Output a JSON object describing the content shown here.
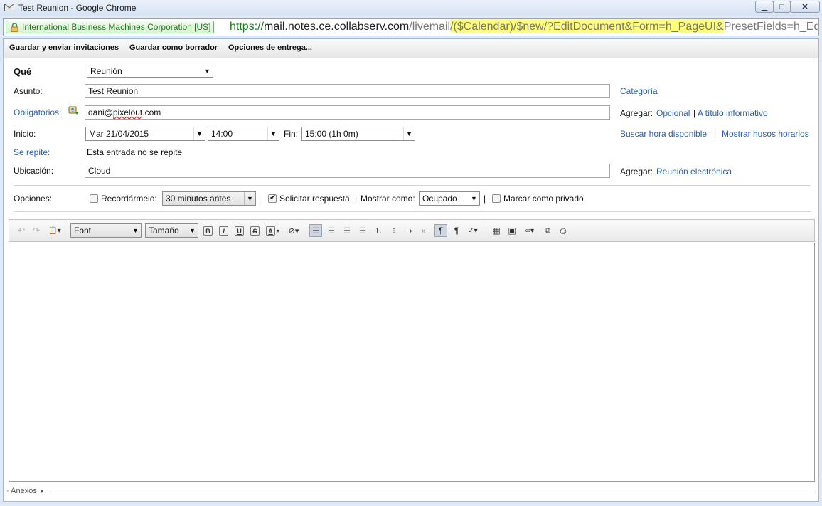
{
  "window": {
    "title": "Test Reunion - Google Chrome",
    "min_symbol": "▁",
    "max_symbol": "□",
    "close_symbol": "✕"
  },
  "addressbar": {
    "ev_label": "International Business Machines Corporation [US]",
    "url_scheme": "https://",
    "url_host": "mail.notes.ce.collabserv.com",
    "url_path_pre": "/livemail",
    "url_path_highlight": "/($Calendar)/$new/?EditDocument&Form=h_PageUI&",
    "url_path_post": "PresetFields=h_Edi"
  },
  "actions": {
    "save_send": "Guardar y enviar invitaciones",
    "save_draft": "Guardar como borrador",
    "delivery_options": "Opciones de entrega..."
  },
  "form": {
    "que_label": "Qué",
    "que_value": "Reunión",
    "asunto_label": "Asunto:",
    "asunto_value": "Test Reunion",
    "categoria_link": "Categoría",
    "obligatorios_label": "Obligatorios:",
    "obligatorios_user": "dani",
    "obligatorios_at": "@",
    "obligatorios_domain_spell": "pixelout",
    "obligatorios_domain_rest": ".com",
    "agregar_label": "Agregar:",
    "opcional_link": "Opcional",
    "pipe": "|",
    "titulo_link": "A título informativo",
    "inicio_label": "Inicio:",
    "inicio_date": "Mar 21/04/2015",
    "inicio_time": "14:00",
    "fin_label": "Fin:",
    "fin_value": "15:00 (1h 0m)",
    "buscar_link": "Buscar hora disponible",
    "mostrar_link": "Mostrar husos horarios",
    "se_repite_label": "Se repite:",
    "se_repite_value": "Esta entrada no se repite",
    "ubicacion_label": "Ubicación:",
    "ubicacion_value": "Cloud",
    "agregar2_label": "Agregar:",
    "reunion_electronica_link": "Reunión electrónica",
    "opciones_label": "Opciones:",
    "recordarmelo_label": "Recordármelo:",
    "recordarmelo_checked": false,
    "recordarmelo_value": "30 minutos antes",
    "solicitar_label": "Solicitar respuesta",
    "solicitar_checked": true,
    "mostrar_como_label": "Mostrar como:",
    "mostrar_como_value": "Ocupado",
    "privado_label": "Marcar como privado",
    "privado_checked": false
  },
  "editor": {
    "font_value": "Font",
    "size_value": "Tamaño",
    "bold": "B",
    "italic": "I",
    "underline": "U",
    "strike": "S",
    "font_color": "A",
    "emoji": "☺"
  },
  "attachments": {
    "label": "Anexos"
  }
}
